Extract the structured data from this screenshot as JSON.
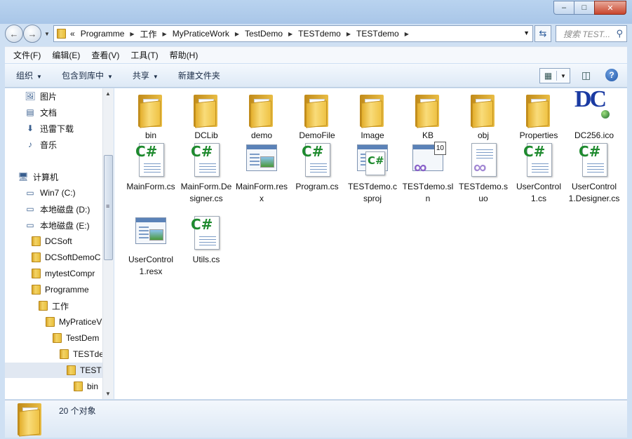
{
  "window": {
    "minimize": "–",
    "maximize": "□",
    "close": "✕"
  },
  "nav": {
    "back": "←",
    "forward": "→",
    "history_dropdown": "▼"
  },
  "address": {
    "overflow": "«",
    "crumbs": [
      "Programme",
      "工作",
      "MyPraticeWork",
      "TestDemo",
      "TESTdemo",
      "TESTdemo"
    ],
    "dropdown": "▼"
  },
  "search": {
    "placeholder": "搜索 TEST...",
    "icon": "search-icon"
  },
  "menu": [
    "文件(F)",
    "编辑(E)",
    "查看(V)",
    "工具(T)",
    "帮助(H)"
  ],
  "toolbar": {
    "organize": "组织",
    "include_library": "包含到库中",
    "share": "共享",
    "new_folder": "新建文件夹"
  },
  "sidebar": {
    "items": [
      {
        "label": "图片",
        "icon": "pictures-icon",
        "depth": 1
      },
      {
        "label": "文档",
        "icon": "documents-icon",
        "depth": 1
      },
      {
        "label": "迅雷下载",
        "icon": "download-icon",
        "depth": 1
      },
      {
        "label": "音乐",
        "icon": "music-icon",
        "depth": 1
      },
      {
        "label": "计算机",
        "icon": "computer-icon",
        "depth": 0
      },
      {
        "label": "Win7 (C:)",
        "icon": "drive-icon",
        "depth": 1
      },
      {
        "label": "本地磁盘 (D:)",
        "icon": "drive-icon",
        "depth": 1
      },
      {
        "label": "本地磁盘 (E:)",
        "icon": "drive-icon",
        "depth": 1
      },
      {
        "label": "DCSoft",
        "icon": "folder-icon",
        "depth": 2
      },
      {
        "label": "DCSoftDemoC",
        "icon": "folder-icon",
        "depth": 2
      },
      {
        "label": "mytestCompr",
        "icon": "folder-icon",
        "depth": 2
      },
      {
        "label": "Programme",
        "icon": "folder-icon",
        "depth": 2
      },
      {
        "label": "工作",
        "icon": "folder-icon",
        "depth": 3
      },
      {
        "label": "MyPraticeV",
        "icon": "folder-icon",
        "depth": 4
      },
      {
        "label": "TestDem",
        "icon": "folder-icon",
        "depth": 5
      },
      {
        "label": "TESTde",
        "icon": "folder-icon",
        "depth": 6
      },
      {
        "label": "TEST",
        "icon": "folder-icon",
        "depth": 7,
        "selected": true
      },
      {
        "label": "bin",
        "icon": "folder-icon",
        "depth": 8
      }
    ]
  },
  "files": [
    {
      "name": "bin",
      "type": "folder"
    },
    {
      "name": "DCLib",
      "type": "folder"
    },
    {
      "name": "demo",
      "type": "folder"
    },
    {
      "name": "DemoFile",
      "type": "folder"
    },
    {
      "name": "Image",
      "type": "folder"
    },
    {
      "name": "KB",
      "type": "folder"
    },
    {
      "name": "obj",
      "type": "folder"
    },
    {
      "name": "Properties",
      "type": "folder"
    },
    {
      "name": "DC256.ico",
      "type": "ico"
    },
    {
      "name": "MainForm.cs",
      "type": "cs"
    },
    {
      "name": "MainForm.Designer.cs",
      "type": "cs"
    },
    {
      "name": "MainForm.resx",
      "type": "resx"
    },
    {
      "name": "Program.cs",
      "type": "cs"
    },
    {
      "name": "TESTdemo.csproj",
      "type": "csproj"
    },
    {
      "name": "TESTdemo.sln",
      "type": "sln"
    },
    {
      "name": "TESTdemo.suo",
      "type": "suo"
    },
    {
      "name": "UserControl1.cs",
      "type": "cs"
    },
    {
      "name": "UserControl1.Designer.cs",
      "type": "cs"
    },
    {
      "name": "UserControl1.resx",
      "type": "resx"
    },
    {
      "name": "Utils.cs",
      "type": "cs"
    }
  ],
  "status": {
    "count": "20 个对象"
  },
  "icon_glyphs": {
    "cs": "C#",
    "sln_badge": "10",
    "dc": "DC"
  }
}
